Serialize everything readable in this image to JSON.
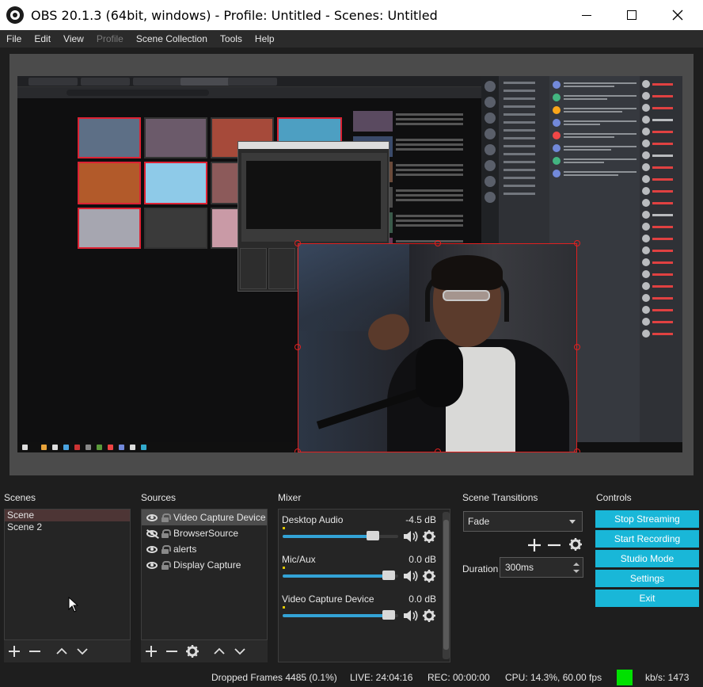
{
  "window": {
    "title": "OBS 20.1.3 (64bit, windows) - Profile: Untitled - Scenes: Untitled"
  },
  "menu": [
    "File",
    "Edit",
    "View",
    "Profile",
    "Scene Collection",
    "Tools",
    "Help"
  ],
  "docks": {
    "scenes_title": "Scenes",
    "sources_title": "Sources",
    "mixer_title": "Mixer",
    "transitions_title": "Scene Transitions",
    "controls_title": "Controls"
  },
  "scenes": [
    "Scene",
    "Scene 2"
  ],
  "sources": [
    {
      "label": "Video Capture Device",
      "visible": true,
      "locked": true,
      "selected": true
    },
    {
      "label": "BrowserSource",
      "visible": false,
      "locked": true,
      "selected": false
    },
    {
      "label": "alerts",
      "visible": true,
      "locked": true,
      "selected": false
    },
    {
      "label": "Display Capture",
      "visible": true,
      "locked": true,
      "selected": false
    }
  ],
  "mixer": [
    {
      "name": "Desktop Audio",
      "db": "-4.5 dB",
      "level": 0.78
    },
    {
      "name": "Mic/Aux",
      "db": "0.0 dB",
      "level": 0.92
    },
    {
      "name": "Video Capture Device",
      "db": "0.0 dB",
      "level": 0.92
    }
  ],
  "transitions": {
    "selected": "Fade",
    "duration_label": "Duration",
    "duration_value": "300ms"
  },
  "controls": [
    "Stop Streaming",
    "Start Recording",
    "Studio Mode",
    "Settings",
    "Exit"
  ],
  "status": {
    "dropped_frames": "Dropped Frames 4485 (0.1%)",
    "live": "LIVE: 24:04:16",
    "rec": "REC: 00:00:00",
    "cpu": "CPU: 14.3%, 60.00 fps",
    "kbps": "kb/s: 1473"
  },
  "colors": {
    "accent": "#19b7d8",
    "selection_handles": "#e02020",
    "status_indicator": "#00e000"
  }
}
